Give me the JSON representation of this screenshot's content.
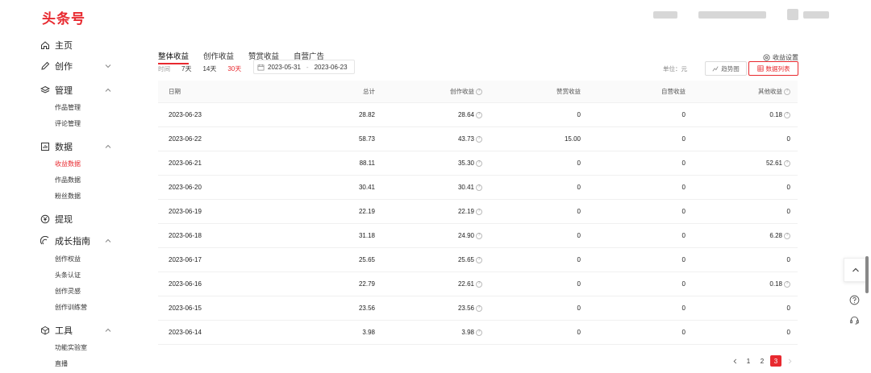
{
  "header": {
    "logo": "头条号"
  },
  "sidebar": {
    "groups": [
      {
        "label": "主页",
        "icon": "home-icon"
      },
      {
        "label": "创作",
        "icon": "edit-icon"
      },
      {
        "label": "管理",
        "icon": "layers-icon"
      },
      {
        "label": "数据",
        "icon": "chart-icon"
      },
      {
        "label": "提现",
        "icon": "yuan-icon"
      },
      {
        "label": "成长指南",
        "icon": "growth-icon"
      },
      {
        "label": "工具",
        "icon": "cube-icon"
      }
    ],
    "subs": {
      "manage": [
        "作品管理",
        "评论管理"
      ],
      "data": [
        "收益数据",
        "作品数据",
        "粉丝数据"
      ],
      "growth": [
        "创作权益",
        "头条认证",
        "创作灵感",
        "创作训练营"
      ],
      "tools": [
        "功能实验室",
        "直播"
      ]
    }
  },
  "tabs": [
    "整体收益",
    "创作收益",
    "赞赏收益",
    "自营广告"
  ],
  "settings_label": "收益设置",
  "time": {
    "label": "时间",
    "options": [
      "7天",
      "14天",
      "30天"
    ],
    "start": "2023-05-31",
    "end": "2023-06-23"
  },
  "unit_label": "单位：元",
  "view": {
    "trend": "趋势图",
    "list": "数据列表"
  },
  "table": {
    "headers": [
      "日期",
      "总计",
      "创作收益",
      "赞赏收益",
      "自营收益",
      "其他收益"
    ],
    "rows": [
      [
        "2023-06-23",
        "28.82",
        "28.64",
        "0",
        "0",
        "0.18"
      ],
      [
        "2023-06-22",
        "58.73",
        "43.73",
        "15.00",
        "0",
        "0"
      ],
      [
        "2023-06-21",
        "88.11",
        "35.30",
        "0",
        "0",
        "52.61"
      ],
      [
        "2023-06-20",
        "30.41",
        "30.41",
        "0",
        "0",
        "0"
      ],
      [
        "2023-06-19",
        "22.19",
        "22.19",
        "0",
        "0",
        "0"
      ],
      [
        "2023-06-18",
        "31.18",
        "24.90",
        "0",
        "0",
        "6.28"
      ],
      [
        "2023-06-17",
        "25.65",
        "25.65",
        "0",
        "0",
        "0"
      ],
      [
        "2023-06-16",
        "22.79",
        "22.61",
        "0",
        "0",
        "0.18"
      ],
      [
        "2023-06-15",
        "23.56",
        "23.56",
        "0",
        "0",
        "0"
      ],
      [
        "2023-06-14",
        "3.98",
        "3.98",
        "0",
        "0",
        "0"
      ]
    ]
  },
  "pager": {
    "pages": [
      "1",
      "2",
      "3"
    ],
    "current": "3"
  },
  "colors": {
    "accent": "#e8292f"
  }
}
